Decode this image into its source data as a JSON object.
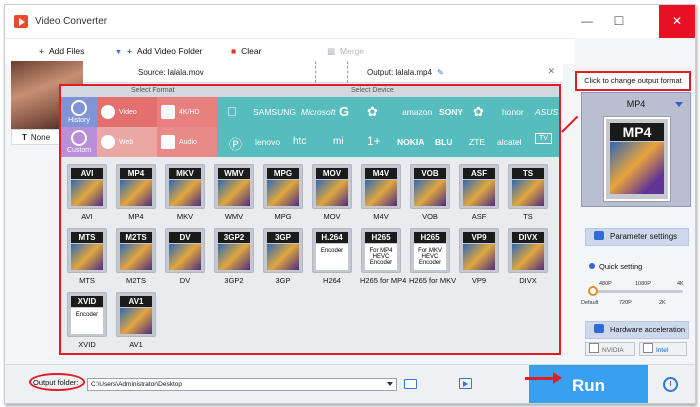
{
  "window": {
    "title": "Video Converter",
    "controls": [
      "minimize",
      "maximize",
      "close"
    ]
  },
  "toolbar": {
    "add_files": "Add Files",
    "add_video_folder": "Add Video Folder",
    "clear": "Clear",
    "merge": "Merge"
  },
  "file": {
    "thumbnail_name": "None",
    "source": "Source: lalala.mov",
    "output": "Output: lalala.mp4"
  },
  "panel": {
    "select_format": "Select Format",
    "select_device": "Select Device",
    "history": "History",
    "custom": "Custom",
    "categories": {
      "video": "Video",
      "hd": "4K/HD",
      "web": "Web",
      "audio": "Audio"
    },
    "brands_row1": [
      "SAMSUNG",
      "Microsoft",
      "G",
      "amazon",
      "SONY",
      "honor",
      "ASUS"
    ],
    "brands_row2": [
      "lenovo",
      "htc",
      "mi",
      "NOKIA",
      "BLU",
      "ZTE",
      "alcatel",
      "TV"
    ],
    "formats": [
      {
        "tag": "AVI",
        "label": "AVI"
      },
      {
        "tag": "MP4",
        "label": "MP4"
      },
      {
        "tag": "MKV",
        "label": "MKV"
      },
      {
        "tag": "WMV",
        "label": "WMV"
      },
      {
        "tag": "MPG",
        "label": "MPG"
      },
      {
        "tag": "MOV",
        "label": "MOV"
      },
      {
        "tag": "M4V",
        "label": "M4V"
      },
      {
        "tag": "VOB",
        "label": "VOB"
      },
      {
        "tag": "ASF",
        "label": "ASF"
      },
      {
        "tag": "TS",
        "label": "TS"
      },
      {
        "tag": "MTS",
        "label": "MTS"
      },
      {
        "tag": "M2TS",
        "label": "M2TS"
      },
      {
        "tag": "DV",
        "label": "DV"
      },
      {
        "tag": "3GP2",
        "label": "3GP2"
      },
      {
        "tag": "3GP",
        "label": "3GP"
      },
      {
        "tag": "H.264",
        "label": "H264",
        "sub": "Encoder"
      },
      {
        "tag": "H265",
        "label": "H265 for MP4",
        "sub": "For MP4 HEVC Encoder"
      },
      {
        "tag": "H265",
        "label": "H265 for MKV",
        "sub": "For MKV HEVC Encoder"
      },
      {
        "tag": "VP9",
        "label": "VP9"
      },
      {
        "tag": "DIVX",
        "label": "DIVX"
      },
      {
        "tag": "XVID",
        "label": "XVID",
        "sub": "Encoder"
      },
      {
        "tag": "AV1",
        "label": "AV1"
      }
    ]
  },
  "right": {
    "hint": "Click to change output format",
    "output_format": "MP4",
    "big_icon_tag": "MP4",
    "parameter_settings": "Parameter settings",
    "quick_setting": "Quick setting",
    "quick_setting_level": 0,
    "ticks_top": [
      "480P",
      "1080P",
      "4K"
    ],
    "ticks_bottom": [
      "Default",
      "720P",
      "2K"
    ],
    "hardware_acceleration": "Hardware acceleration",
    "chips": [
      "NVIDIA",
      "Intel"
    ]
  },
  "bottom": {
    "output_folder_label": "Output folder:",
    "output_path": "C:\\Users\\Administrator\\Desktop",
    "run": "Run"
  },
  "colors": {
    "accent_red": "#e31b23",
    "run_blue": "#39a0f0",
    "device_teal": "#56bcbd",
    "format_red": "#e36f6f",
    "history_blue": "#7f95d6"
  }
}
